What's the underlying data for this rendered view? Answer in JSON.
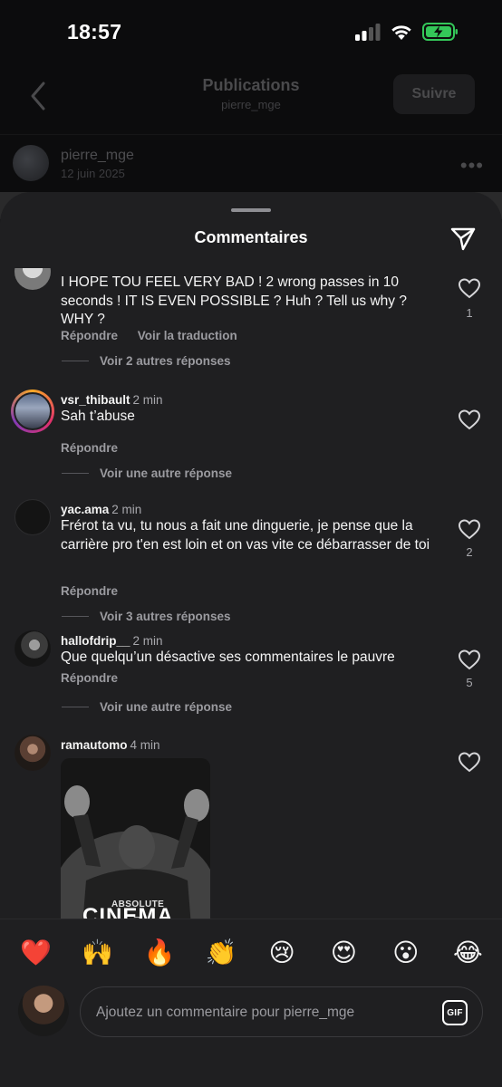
{
  "status_bar": {
    "time": "18:57"
  },
  "header": {
    "title": "Publications",
    "subtitle": "pierre_mge",
    "follow_label": "Suivre"
  },
  "post": {
    "username": "pierre_mge",
    "date": "12 juin 2025"
  },
  "sheet": {
    "title": "Commentaires"
  },
  "comments": [
    {
      "username": "",
      "time": "",
      "text": "I HOPE TOU FEEL VERY BAD ! 2 wrong passes in 10 seconds ! IT IS EVEN POSSIBLE ? Huh ? Tell us why ? WHY ?",
      "reply_label": "Répondre",
      "translate_label": "Voir la traduction",
      "more_replies": "Voir 2 autres réponses",
      "likes": "1"
    },
    {
      "username": "vsr_thibault",
      "time": "2 min",
      "text": "Sah t’abuse",
      "reply_label": "Répondre",
      "more_replies": "Voir une autre réponse",
      "likes": ""
    },
    {
      "username": "yac.ama",
      "time": "2 min",
      "text": "Frérot ta vu, tu nous a fait une dinguerie, je pense que la carrière pro t'en est loin et on vas vite ce débarrasser de toi",
      "reply_label": "Répondre",
      "more_replies": "Voir 3 autres réponses",
      "likes": "2"
    },
    {
      "username": "hallofdrip__",
      "time": "2 min",
      "text": "Que quelqu’un désactive ses commentaires le pauvre",
      "reply_label": "Répondre",
      "more_replies": "Voir une autre réponse",
      "likes": "5"
    },
    {
      "username": "ramautomo",
      "time": "4 min",
      "gif_text_small": "ABSOLUTE",
      "gif_text_big": "CINEMA",
      "likes": ""
    }
  ],
  "emoji_reactions": [
    "❤️",
    "🙌",
    "🔥",
    "👏",
    "😢",
    "😍",
    "😮",
    "😂"
  ],
  "input": {
    "placeholder": "Ajoutez un commentaire pour pierre_mge",
    "gif_label": "GIF"
  },
  "colors": {
    "sheet_bg": "#1f1f21",
    "page_bg": "#0c0c0d",
    "battery_green": "#34c759",
    "story_ring": "#e1306c"
  }
}
